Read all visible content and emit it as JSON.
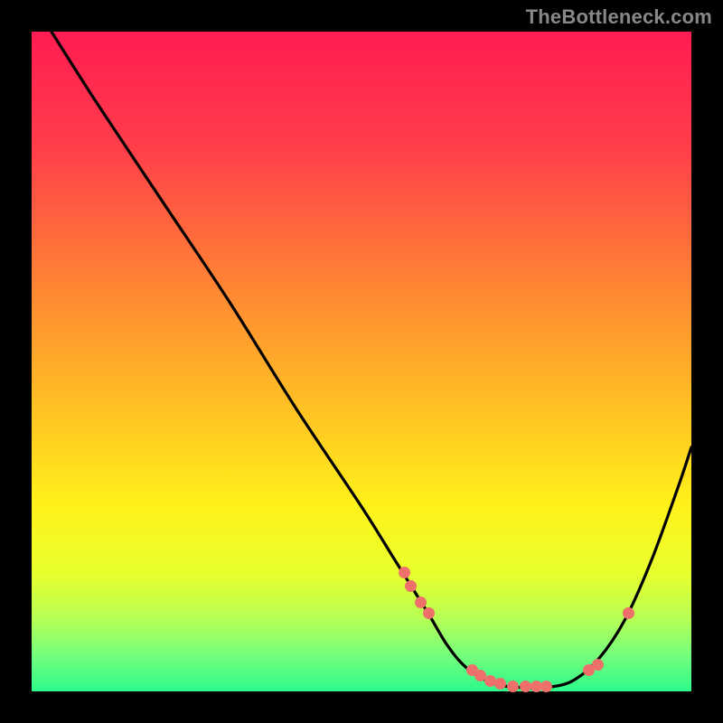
{
  "watermark": "TheBottleneck.com",
  "chart_data": {
    "type": "line",
    "title": "",
    "xlabel": "",
    "ylabel": "",
    "xlim": [
      0,
      100
    ],
    "ylim": [
      0,
      100
    ],
    "gradient_stops": [
      {
        "offset": 0,
        "color": "#ff1c52"
      },
      {
        "offset": 18,
        "color": "#ff3f4a"
      },
      {
        "offset": 40,
        "color": "#ff8a32"
      },
      {
        "offset": 58,
        "color": "#ffc423"
      },
      {
        "offset": 72,
        "color": "#fff21a"
      },
      {
        "offset": 82,
        "color": "#e9ff2e"
      },
      {
        "offset": 89,
        "color": "#b6ff55"
      },
      {
        "offset": 94,
        "color": "#7cff7a"
      },
      {
        "offset": 100,
        "color": "#2dfa8b"
      }
    ],
    "series": [
      {
        "name": "bottleneck-curve",
        "x": [
          3,
          10,
          20,
          30,
          40,
          50,
          55,
          60,
          63,
          66,
          70,
          74,
          78,
          82,
          86,
          90,
          94,
          98,
          100
        ],
        "y": [
          100,
          89,
          74,
          59,
          43,
          28,
          20,
          12,
          7,
          3.5,
          1.2,
          0.6,
          0.6,
          1.6,
          5,
          11,
          20,
          31,
          37
        ]
      }
    ],
    "markers": {
      "name": "highlight-dots",
      "x": [
        56.5,
        57.5,
        59,
        60.2,
        66.8,
        68,
        69.5,
        71,
        73,
        74.8,
        76.5,
        78,
        84.5,
        85.8,
        90.5
      ],
      "y": [
        18,
        16,
        13.5,
        11.8,
        3.2,
        2.4,
        1.6,
        1.1,
        0.8,
        0.7,
        0.7,
        0.8,
        3.2,
        4.1,
        11.8
      ]
    }
  }
}
